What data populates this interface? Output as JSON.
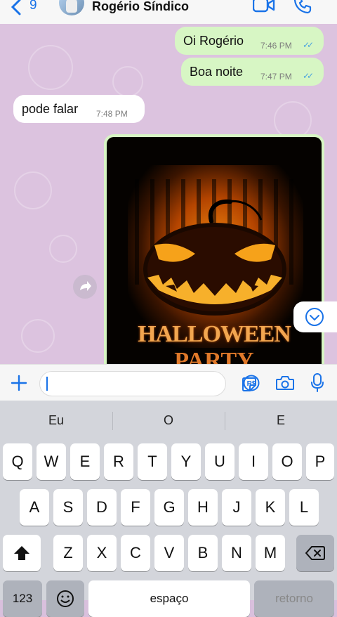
{
  "header": {
    "back_count": "9",
    "contact_name": "Rogério Síndico"
  },
  "messages": [
    {
      "text": "Oi Rogério",
      "time": "7:46 PM",
      "direction": "out",
      "status": "read"
    },
    {
      "text": "Boa noite",
      "time": "7:47 PM",
      "direction": "out",
      "status": "read"
    },
    {
      "text": "pode falar",
      "time": "7:48 PM",
      "direction": "in"
    }
  ],
  "image_message": {
    "title_line1": "HALLOWEEN",
    "title_line2": "PARTY"
  },
  "input": {
    "value": "",
    "placeholder": ""
  },
  "keyboard": {
    "suggestions": [
      "Eu",
      "O",
      "E"
    ],
    "row1": [
      "Q",
      "W",
      "E",
      "R",
      "T",
      "Y",
      "U",
      "I",
      "O",
      "P"
    ],
    "row2": [
      "A",
      "S",
      "D",
      "F",
      "G",
      "H",
      "J",
      "K",
      "L"
    ],
    "row3": [
      "Z",
      "X",
      "C",
      "V",
      "B",
      "N",
      "M"
    ],
    "numbers_label": "123",
    "space_label": "espaço",
    "return_label": "retorno"
  },
  "colors": {
    "outgoing_bubble": "#d7f6c4",
    "incoming_bubble": "#ffffff",
    "accent": "#1a73e8",
    "chat_background": "#dcc3df"
  },
  "icons": [
    "chevron-left-icon",
    "video-call-icon",
    "phone-icon",
    "forward-icon",
    "chevron-down-icon",
    "plus-icon",
    "sticker-icon",
    "pix-icon",
    "camera-icon",
    "microphone-icon",
    "shift-icon",
    "backspace-icon",
    "emoji-icon"
  ]
}
